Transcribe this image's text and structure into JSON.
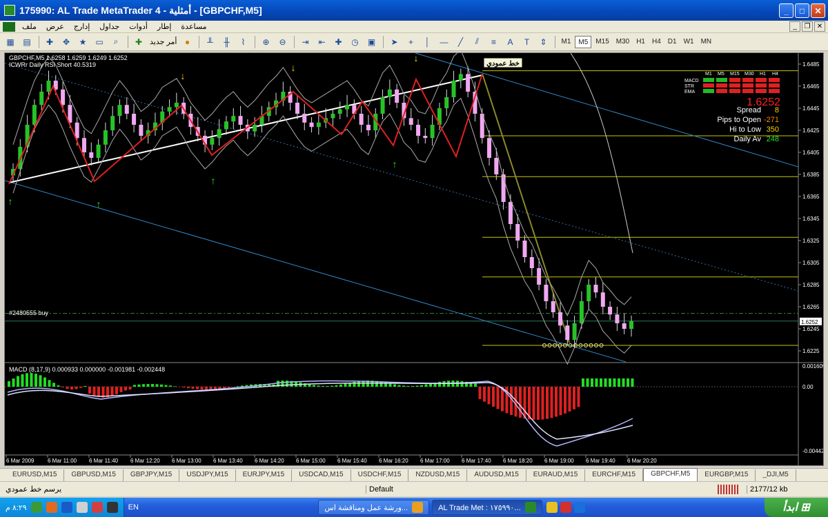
{
  "window": {
    "title": "175990: AL Trade MetaTrader 4 - أمثلية - [GBPCHF,M5]"
  },
  "menu": [
    "ملف",
    "عرض",
    "إدارج",
    "جداول",
    "أدوات",
    "إطار",
    "مساعدة"
  ],
  "toolbar": {
    "new_order": "أمر جديد",
    "timeframes": [
      "M1",
      "M5",
      "M15",
      "M30",
      "H1",
      "H4",
      "D1",
      "W1",
      "MN"
    ],
    "active_timeframe": "M5"
  },
  "chart": {
    "header": "GBPCHF,M5  1.6258 1.6259 1.6249 1.6252",
    "indicator_line": "ICWRr Daily RSI  Short 40.5319",
    "order_label": "#2480555 buy",
    "vline_label": "خط عمودي",
    "price_ticks": [
      "1.6485",
      "1.6465",
      "1.6445",
      "1.6425",
      "1.6405",
      "1.6385",
      "1.6365",
      "1.6345",
      "1.6325",
      "1.6305",
      "1.6285",
      "1.6265",
      "1.6245",
      "1.6225"
    ],
    "current_price": "1.6252",
    "time_ticks": [
      "6 Mar 2009",
      "6 Mar 11:00",
      "6 Mar 11:40",
      "6 Mar 12:20",
      "6 Mar 13:00",
      "6 Mar 13:40",
      "6 Mar 14:20",
      "6 Mar 15:00",
      "6 Mar 15:40",
      "6 Mar 16:20",
      "6 Mar 17:00",
      "6 Mar 17:40",
      "6 Mar 18:20",
      "6 Mar 19:00",
      "6 Mar 19:40",
      "6 Mar 20:20"
    ],
    "panel": {
      "columns": [
        "M1",
        "M5",
        "M15",
        "M30",
        "H1",
        "H4"
      ],
      "rows": [
        "MACD",
        "STR",
        "EMA"
      ],
      "price": "1.6252",
      "stats": [
        {
          "label": "Spread",
          "value": "8",
          "color": "#ffd000"
        },
        {
          "label": "Pips to Open",
          "value": "-271",
          "color": "#ff8a00"
        },
        {
          "label": "Hi to Low",
          "value": "350",
          "color": "#ffd000"
        },
        {
          "label": "Daily Av",
          "value": "248",
          "color": "#33dd33"
        }
      ]
    },
    "macd_header": "MACD (8,17,9) 0.000933 0.000000 -0.001981 -0.002448",
    "macd_ticks": [
      "0.001609",
      "0.00",
      "-0.00442"
    ]
  },
  "chart_data": {
    "type": "candlestick",
    "symbol": "GBPCHF",
    "timeframe": "M5",
    "ylim": [
      1.6215,
      1.6495
    ],
    "series": [
      {
        "name": "GBPCHF,M5",
        "close": [
          1.639,
          1.641,
          1.643,
          1.6448,
          1.646,
          1.647,
          1.6462,
          1.6448,
          1.6432,
          1.6418,
          1.6405,
          1.64,
          1.6412,
          1.6425,
          1.6438,
          1.6448,
          1.644,
          1.643,
          1.642,
          1.6425,
          1.6432,
          1.6442,
          1.6446,
          1.645,
          1.644,
          1.6428,
          1.642,
          1.6412,
          1.6418,
          1.6426,
          1.6433,
          1.6438,
          1.643,
          1.6424,
          1.643,
          1.6438,
          1.6446,
          1.6452,
          1.646,
          1.645,
          1.644,
          1.6432,
          1.6428,
          1.6432,
          1.6436,
          1.644,
          1.6444,
          1.6448,
          1.644,
          1.643,
          1.6425,
          1.644,
          1.6455,
          1.6462,
          1.645,
          1.6436,
          1.643,
          1.642,
          1.6418,
          1.643,
          1.6445,
          1.6455,
          1.647,
          1.6476,
          1.646,
          1.644,
          1.6418,
          1.64,
          1.6385,
          1.636,
          1.634,
          1.6325,
          1.631,
          1.63,
          1.6285,
          1.627,
          1.626,
          1.6248,
          1.6235,
          1.625,
          1.627,
          1.6285,
          1.6278,
          1.6265,
          1.6258,
          1.625,
          1.6245,
          1.6252
        ]
      }
    ],
    "macd": {
      "min": -0.00442,
      "max": 0.001609
    }
  }
}
